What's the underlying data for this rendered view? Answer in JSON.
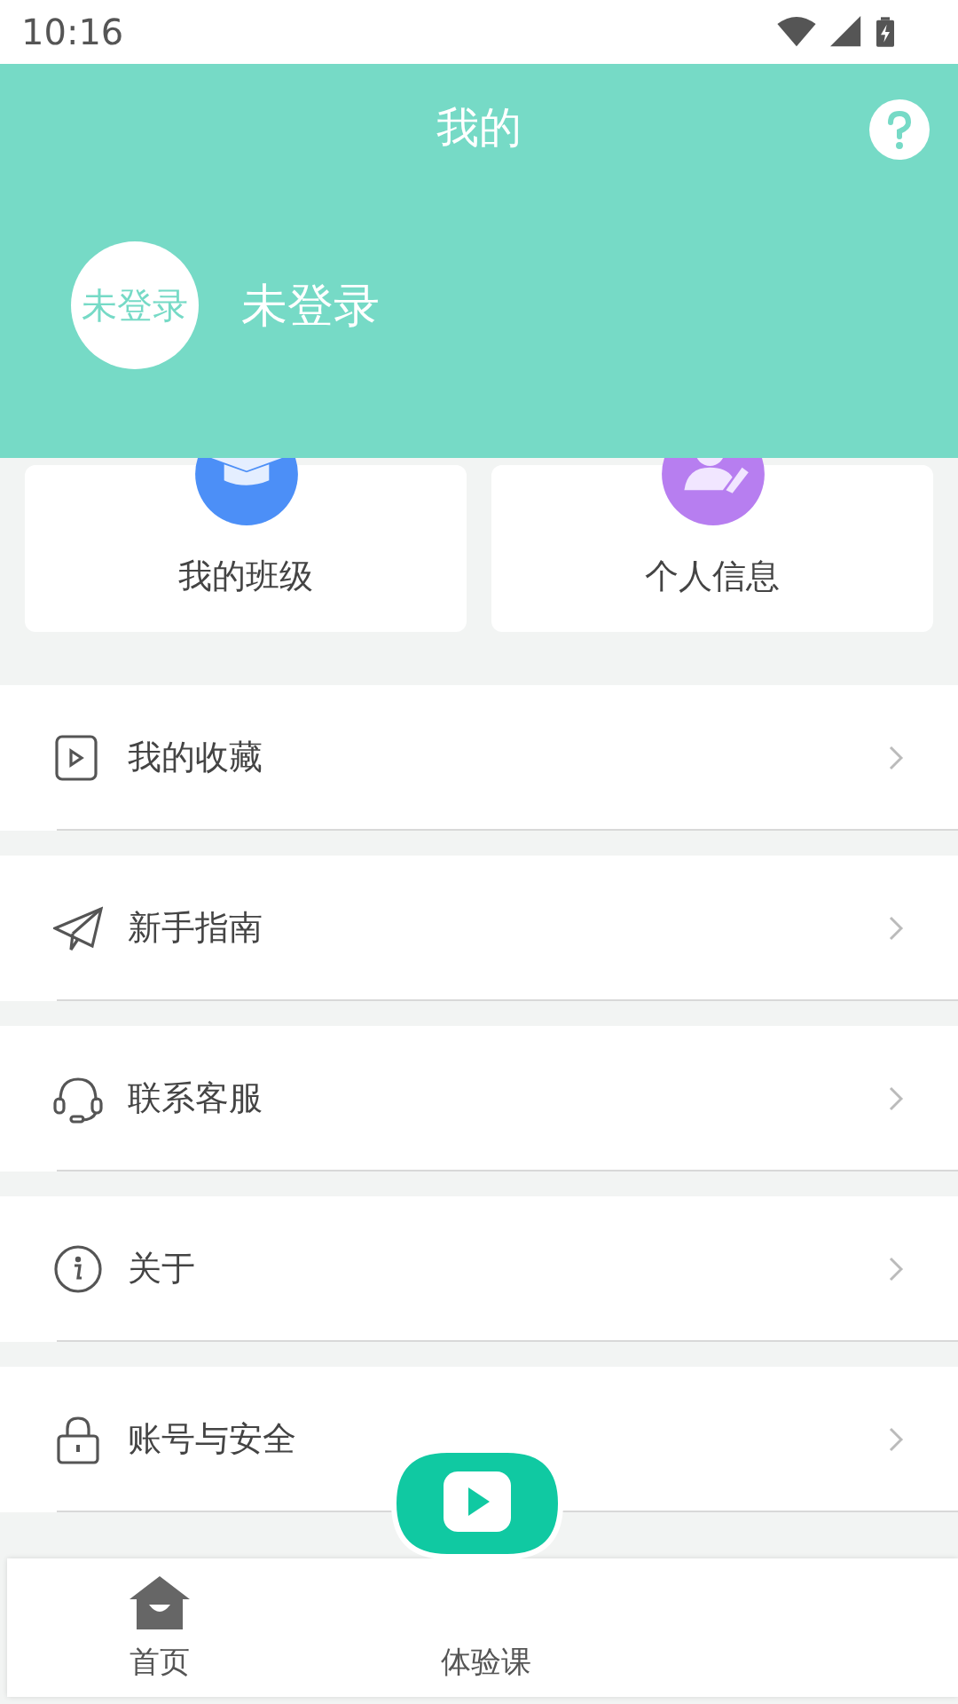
{
  "status_bar": {
    "time": "10:16"
  },
  "header": {
    "title": "我的",
    "avatar_text": "未登录",
    "user_name": "未登录"
  },
  "cards": [
    {
      "kind": "class",
      "label": "我的班级"
    },
    {
      "kind": "profile",
      "label": "个人信息"
    }
  ],
  "menu": [
    {
      "kind": "favorites",
      "label": "我的收藏"
    },
    {
      "kind": "guide",
      "label": "新手指南"
    },
    {
      "kind": "service",
      "label": "联系客服"
    },
    {
      "kind": "about",
      "label": "关于"
    },
    {
      "kind": "security",
      "label": "账号与安全"
    }
  ],
  "bottom_nav": [
    {
      "kind": "home",
      "label": "首页"
    },
    {
      "kind": "trial",
      "label": "体验课"
    }
  ]
}
